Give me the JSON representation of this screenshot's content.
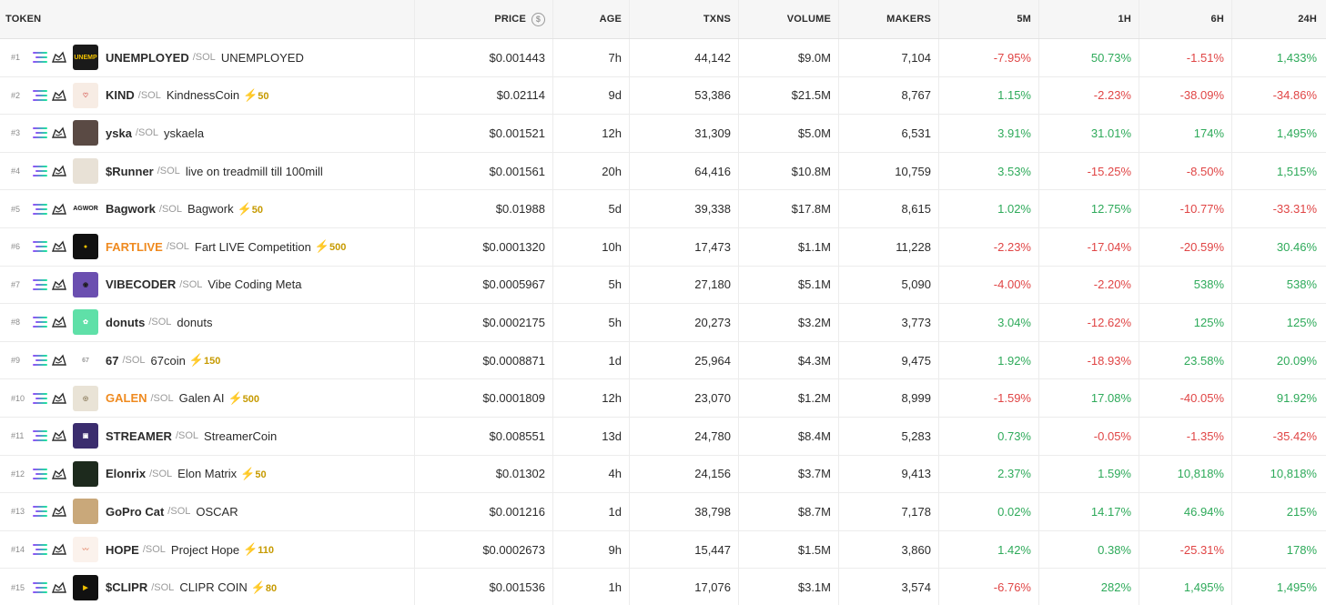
{
  "headers": {
    "token": "TOKEN",
    "price": "PRICE",
    "age": "AGE",
    "txns": "TXNS",
    "volume": "VOLUME",
    "makers": "MAKERS",
    "p5m": "5M",
    "p1h": "1H",
    "p6h": "6H",
    "p24h": "24H"
  },
  "colors": {
    "positive": "#2eaa5a",
    "negative": "#e04545",
    "boost": "#c69a00",
    "highlight_symbol": "#ef8a1f"
  },
  "rows": [
    {
      "rank": "#1",
      "symbol": "UNEMPLOYED",
      "quote": "/SOL",
      "name": "UNEMPLOYED",
      "boost": "",
      "price": "$0.001443",
      "age": "7h",
      "txns": "44,142",
      "volume": "$9.0M",
      "makers": "7,104",
      "p5m": "-7.95%",
      "p1h": "50.73%",
      "p6h": "-1.51%",
      "p24h": "1,433%",
      "avatar_bg": "#1a1a1a",
      "avatar_fg": "#f5c400",
      "avatar_text": "UNEMP",
      "avatar_icon": "unemployed-logo-icon"
    },
    {
      "rank": "#2",
      "symbol": "KIND",
      "quote": "/SOL",
      "name": "KindnessCoin",
      "boost": "50",
      "price": "$0.02114",
      "age": "9d",
      "txns": "53,386",
      "volume": "$21.5M",
      "makers": "8,767",
      "p5m": "1.15%",
      "p1h": "-2.23%",
      "p6h": "-38.09%",
      "p24h": "-34.86%",
      "avatar_bg": "#f7ece4",
      "avatar_fg": "#d0403a",
      "avatar_text": "♡",
      "avatar_icon": "heart-icon"
    },
    {
      "rank": "#3",
      "symbol": "yska",
      "quote": "/SOL",
      "name": "yskaela",
      "boost": "",
      "price": "$0.001521",
      "age": "12h",
      "txns": "31,309",
      "volume": "$5.0M",
      "makers": "6,531",
      "p5m": "3.91%",
      "p1h": "31.01%",
      "p6h": "174%",
      "p24h": "1,495%",
      "avatar_bg": "#5a4a44",
      "avatar_fg": "#d9c4b8",
      "avatar_text": "",
      "avatar_icon": "person-photo-icon"
    },
    {
      "rank": "#4",
      "symbol": "$Runner",
      "quote": "/SOL",
      "name": "live on treadmill till 100mill",
      "boost": "",
      "price": "$0.001561",
      "age": "20h",
      "txns": "64,416",
      "volume": "$10.8M",
      "makers": "10,759",
      "p5m": "3.53%",
      "p1h": "-15.25%",
      "p6h": "-8.50%",
      "p24h": "1,515%",
      "avatar_bg": "#e8e1d6",
      "avatar_fg": "#6b5a48",
      "avatar_text": "",
      "avatar_icon": "runner-photo-icon"
    },
    {
      "rank": "#5",
      "symbol": "Bagwork",
      "quote": "/SOL",
      "name": "Bagwork",
      "boost": "50",
      "price": "$0.01988",
      "age": "5d",
      "txns": "39,338",
      "volume": "$17.8M",
      "makers": "8,615",
      "p5m": "1.02%",
      "p1h": "12.75%",
      "p6h": "-10.77%",
      "p24h": "-33.31%",
      "avatar_bg": "#ffffff",
      "avatar_fg": "#111111",
      "avatar_text": "BAGWORK",
      "avatar_icon": "bagwork-logo-icon"
    },
    {
      "rank": "#6",
      "symbol": "FARTLIVE",
      "quote": "/SOL",
      "name": "Fart LIVE Competition",
      "boost": "500",
      "price": "$0.0001320",
      "age": "10h",
      "txns": "17,473",
      "volume": "$1.1M",
      "makers": "11,228",
      "p5m": "-2.23%",
      "p1h": "-17.04%",
      "p6h": "-20.59%",
      "p24h": "30.46%",
      "avatar_bg": "#111111",
      "avatar_fg": "#f2c200",
      "avatar_text": "●",
      "avatar_icon": "fartlive-logo-icon",
      "highlight": true
    },
    {
      "rank": "#7",
      "symbol": "VIBECODER",
      "quote": "/SOL",
      "name": "Vibe Coding Meta",
      "boost": "",
      "price": "$0.0005967",
      "age": "5h",
      "txns": "27,180",
      "volume": "$5.1M",
      "makers": "5,090",
      "p5m": "-4.00%",
      "p1h": "-2.20%",
      "p6h": "538%",
      "p24h": "538%",
      "avatar_bg": "#6b4fb0",
      "avatar_fg": "#1b1b1b",
      "avatar_text": "◉",
      "avatar_icon": "hooded-coder-icon"
    },
    {
      "rank": "#8",
      "symbol": "donuts",
      "quote": "/SOL",
      "name": "donuts",
      "boost": "",
      "price": "$0.0002175",
      "age": "5h",
      "txns": "20,273",
      "volume": "$3.2M",
      "makers": "3,773",
      "p5m": "3.04%",
      "p1h": "-12.62%",
      "p6h": "125%",
      "p24h": "125%",
      "avatar_bg": "#5fe0a8",
      "avatar_fg": "#ffffff",
      "avatar_text": "✿",
      "avatar_icon": "donut-icon"
    },
    {
      "rank": "#9",
      "symbol": "67",
      "quote": "/SOL",
      "name": "67coin",
      "boost": "150",
      "price": "$0.0008871",
      "age": "1d",
      "txns": "25,964",
      "volume": "$4.3M",
      "makers": "9,475",
      "p5m": "1.92%",
      "p1h": "-18.93%",
      "p6h": "23.58%",
      "p24h": "20.09%",
      "avatar_bg": "#ffffff",
      "avatar_fg": "#9a9a9a",
      "avatar_text": "67",
      "avatar_icon": "67coin-logo-icon"
    },
    {
      "rank": "#10",
      "symbol": "GALEN",
      "quote": "/SOL",
      "name": "Galen AI",
      "boost": "500",
      "price": "$0.0001809",
      "age": "12h",
      "txns": "23,070",
      "volume": "$1.2M",
      "makers": "8,999",
      "p5m": "-1.59%",
      "p1h": "17.08%",
      "p6h": "-40.05%",
      "p24h": "91.92%",
      "avatar_bg": "#e9e3d6",
      "avatar_fg": "#8a7a5a",
      "avatar_text": "◎",
      "avatar_icon": "galen-portrait-icon",
      "highlight": true
    },
    {
      "rank": "#11",
      "symbol": "STREAMER",
      "quote": "/SOL",
      "name": "StreamerCoin",
      "boost": "",
      "price": "$0.008551",
      "age": "13d",
      "txns": "24,780",
      "volume": "$8.4M",
      "makers": "5,283",
      "p5m": "0.73%",
      "p1h": "-0.05%",
      "p6h": "-1.35%",
      "p24h": "-35.42%",
      "avatar_bg": "#3b2d6e",
      "avatar_fg": "#ffffff",
      "avatar_text": "▣",
      "avatar_icon": "tv-icon"
    },
    {
      "rank": "#12",
      "symbol": "Elonrix",
      "quote": "/SOL",
      "name": "Elon Matrix",
      "boost": "50",
      "price": "$0.01302",
      "age": "4h",
      "txns": "24,156",
      "volume": "$3.7M",
      "makers": "9,413",
      "p5m": "2.37%",
      "p1h": "1.59%",
      "p6h": "10,818%",
      "p24h": "10,818%",
      "avatar_bg": "#1d2a1d",
      "avatar_fg": "#7fd47f",
      "avatar_text": "",
      "avatar_icon": "matrix-portrait-icon"
    },
    {
      "rank": "#13",
      "symbol": "GoPro Cat",
      "quote": "/SOL",
      "name": "OSCAR",
      "boost": "",
      "price": "$0.001216",
      "age": "1d",
      "txns": "38,798",
      "volume": "$8.7M",
      "makers": "7,178",
      "p5m": "0.02%",
      "p1h": "14.17%",
      "p6h": "46.94%",
      "p24h": "215%",
      "avatar_bg": "#c9a87a",
      "avatar_fg": "#6b4e2e",
      "avatar_text": "",
      "avatar_icon": "cat-photo-icon"
    },
    {
      "rank": "#14",
      "symbol": "HOPE",
      "quote": "/SOL",
      "name": "Project Hope",
      "boost": "110",
      "price": "$0.0002673",
      "age": "9h",
      "txns": "15,447",
      "volume": "$1.5M",
      "makers": "3,860",
      "p5m": "1.42%",
      "p1h": "0.38%",
      "p6h": "-25.31%",
      "p24h": "178%",
      "avatar_bg": "#fbf2ec",
      "avatar_fg": "#e07a5a",
      "avatar_text": "〰",
      "avatar_icon": "hope-worm-icon"
    },
    {
      "rank": "#15",
      "symbol": "$CLIPR",
      "quote": "/SOL",
      "name": "CLIPR COIN",
      "boost": "80",
      "price": "$0.001536",
      "age": "1h",
      "txns": "17,076",
      "volume": "$3.1M",
      "makers": "3,574",
      "p5m": "-6.76%",
      "p1h": "282%",
      "p6h": "1,495%",
      "p24h": "1,495%",
      "avatar_bg": "#111111",
      "avatar_fg": "#f2c200",
      "avatar_text": "▶",
      "avatar_icon": "clapper-icon"
    }
  ]
}
